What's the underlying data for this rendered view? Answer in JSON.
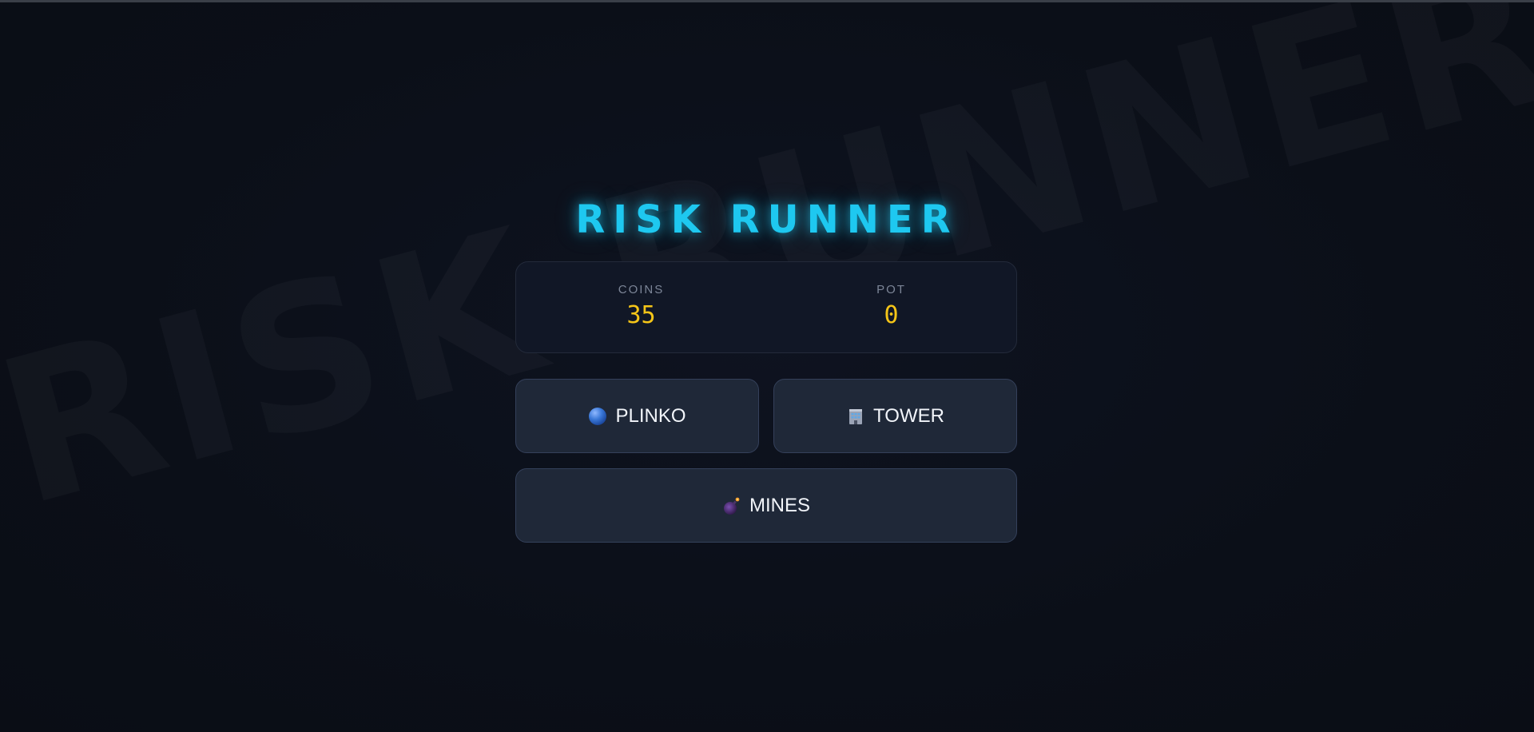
{
  "title": "RISK RUNNER",
  "watermark": "RISK RUNNER",
  "stats": {
    "coins_label": "COINS",
    "coins_value": "35",
    "pot_label": "POT",
    "pot_value": "0"
  },
  "games": {
    "plinko": {
      "label": "PLINKO",
      "icon": "blue-ball-icon"
    },
    "tower": {
      "label": "TOWER",
      "icon": "building-icon"
    },
    "mines": {
      "label": "MINES",
      "icon": "bomb-icon"
    }
  },
  "colors": {
    "background": "#0b0f18",
    "title": "#1ec8f0",
    "value": "#f5c518",
    "label": "#7c8597",
    "button_bg": "#1f2838",
    "button_border": "#34405a"
  }
}
